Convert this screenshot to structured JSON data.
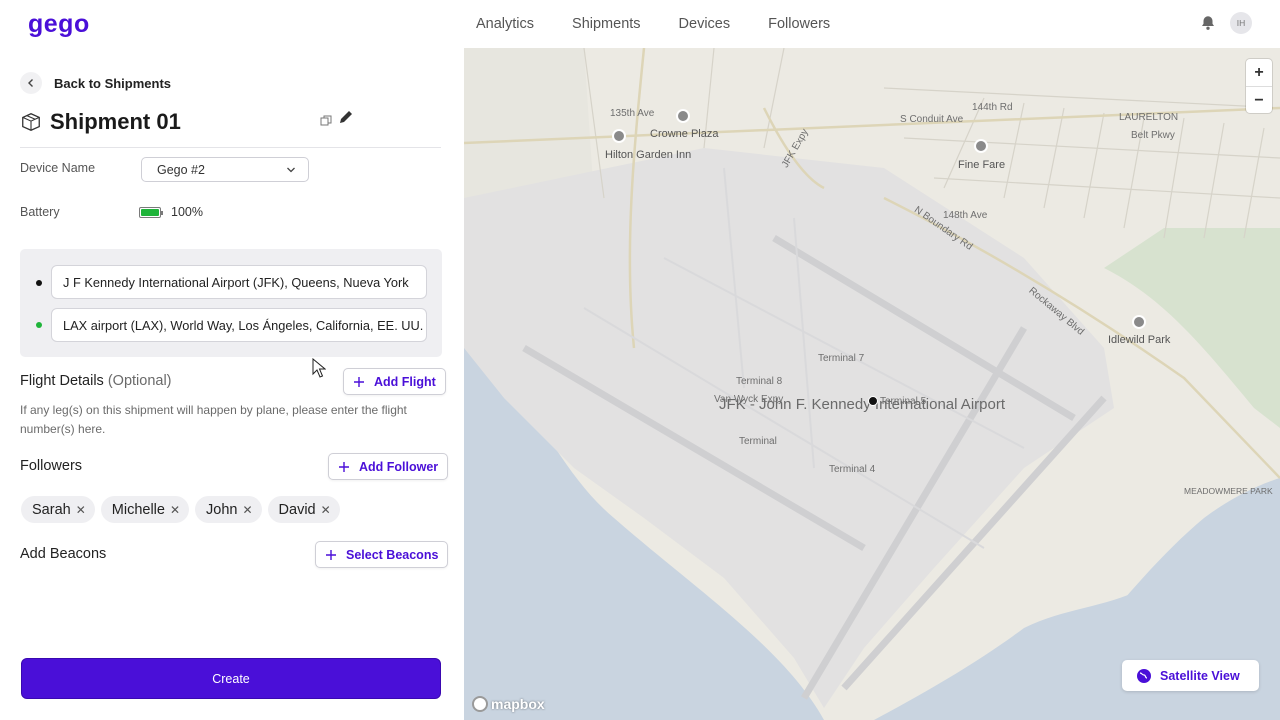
{
  "brand": {
    "logo_text": "gego",
    "accent_color": "#4a0fd8"
  },
  "nav": {
    "items": [
      "Analytics",
      "Shipments",
      "Devices",
      "Followers"
    ],
    "avatar_initials": "IH"
  },
  "panel": {
    "back_label": "Back to Shipments",
    "title": "Shipment 01",
    "device_name_label": "Device Name",
    "device_name_value": "Gego #2",
    "battery_label": "Battery",
    "battery_value": "100%",
    "battery_level": 1.0,
    "origin_value": "J F Kennedy International Airport (JFK), Queens, Nueva York",
    "destination_value": "LAX airport (LAX), World Way, Los Ángeles, California, EE. UU.",
    "flight_title": "Flight Details",
    "flight_optional": "(Optional)",
    "add_flight_label": "Add Flight",
    "flight_hint": "If any leg(s) on this shipment will happen by plane, please enter the flight number(s) here.",
    "followers_title": "Followers",
    "add_follower_label": "Add Follower",
    "followers": [
      "Sarah",
      "Michelle",
      "John",
      "David"
    ],
    "beacons_title": "Add Beacons",
    "select_beacons_label": "Select Beacons",
    "create_label": "Create"
  },
  "map": {
    "zoom_in": "+",
    "zoom_out": "−",
    "satellite_label": "Satellite View",
    "attribution": "mapbox",
    "labels": {
      "airport": "JFK - John F. Kennedy International Airport",
      "terminal_7": "Terminal 7",
      "terminal_8": "Terminal 8",
      "terminal_5": "Terminal 5",
      "terminal_4": "Terminal 4",
      "terminal": "Terminal",
      "van_wyck_expy": "Van Wyck Expy",
      "crowne_plaza": "Crowne Plaza",
      "hilton_garden_inn": "Hilton Garden Inn",
      "fine_fare": "Fine Fare",
      "idlewild_park": "Idlewild Park",
      "laurelton": "LAURELTON",
      "belt_pkwy": "Belt Pkwy",
      "s_conduit_ave": "S Conduit Ave",
      "rockaway_blvd": "Rockaway Blvd",
      "n_boundary_rd": "N Boundary Rd",
      "meadowmere_park": "MEADOWMERE PARK",
      "ave_135th": "135th Ave",
      "ave_144th": "144th Rd",
      "ave_148th": "148th Ave",
      "jfk_expy": "JFK Expy",
      "laurelton_small": "Laurelton"
    }
  }
}
